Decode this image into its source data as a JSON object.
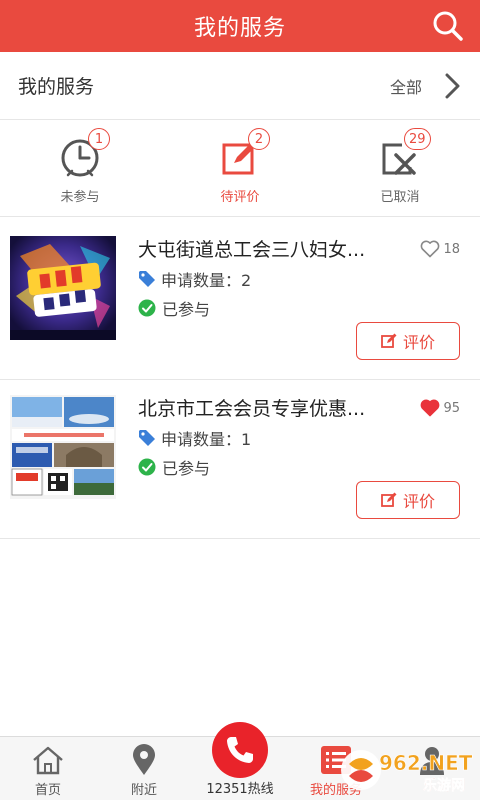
{
  "header": {
    "title": "我的服务"
  },
  "section": {
    "title": "我的服务",
    "all_label": "全部"
  },
  "status_tabs": [
    {
      "label": "未参与",
      "count": "1",
      "active": false
    },
    {
      "label": "待评价",
      "count": "2",
      "active": true
    },
    {
      "label": "已取消",
      "count": "29",
      "active": false
    }
  ],
  "cards": [
    {
      "title": "大屯街道总工会三八妇女...",
      "likes": "18",
      "liked": false,
      "qty": "申请数量：2",
      "state": "已参与",
      "action": "评价"
    },
    {
      "title": "北京市工会会员专享优惠...",
      "likes": "95",
      "liked": true,
      "qty": "申请数量：1",
      "state": "已参与",
      "action": "评价"
    }
  ],
  "nav": {
    "home": "首页",
    "nearby": "附近",
    "hotline": "12351热线",
    "my_services": "我的服务"
  },
  "watermark": {
    "text": "962.NET",
    "sub": "乐游网"
  },
  "colors": {
    "accent": "#e94a3f",
    "like_red": "#e9323a",
    "tag_blue": "#3a7fd8",
    "check_green": "#2db34a"
  }
}
